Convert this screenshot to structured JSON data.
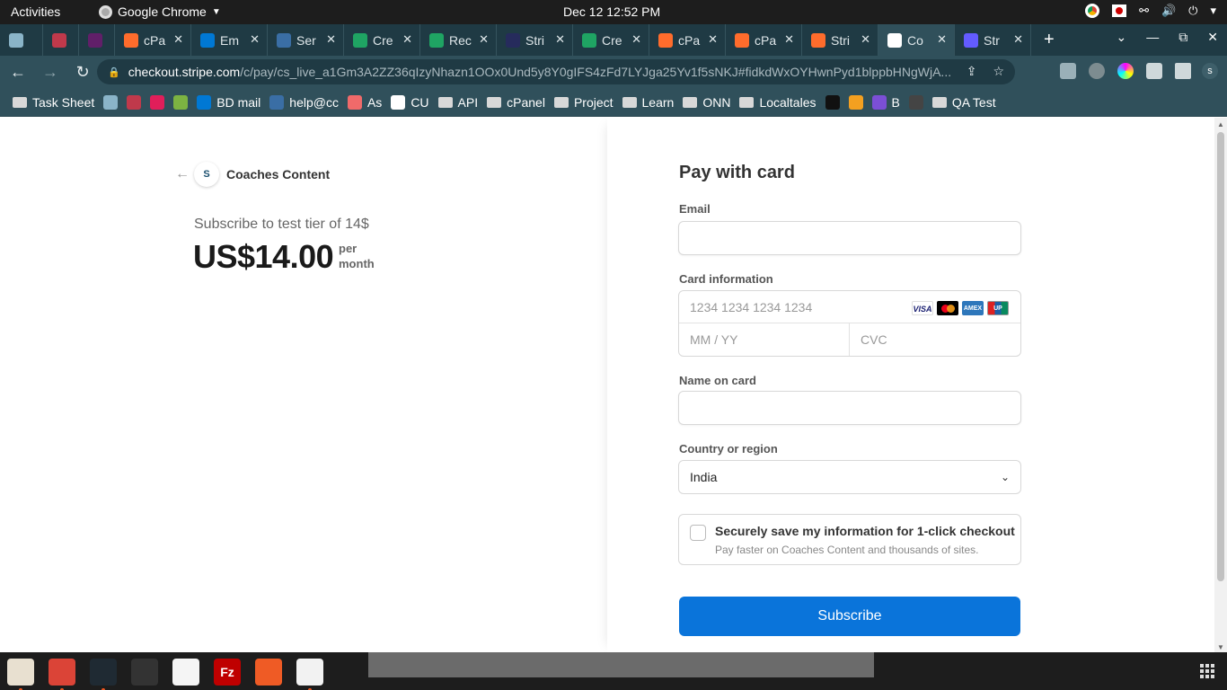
{
  "system": {
    "activities": "Activities",
    "app_name": "Google Chrome",
    "clock": "Dec 12  12:52 PM"
  },
  "tabs": [
    {
      "title": "",
      "favicon": "home-icon",
      "color": "#8ab4c8"
    },
    {
      "title": "",
      "favicon": "chat-icon",
      "color": "#c0394b"
    },
    {
      "title": "",
      "favicon": "slack-icon",
      "color": "#611f69"
    },
    {
      "title": "cPa",
      "favicon": "cpanel-icon",
      "color": "#ff6c2c"
    },
    {
      "title": "Em",
      "favicon": "outlook-icon",
      "color": "#0078d4"
    },
    {
      "title": "Ser",
      "favicon": "cc-icon",
      "color": "#3a6ea5"
    },
    {
      "title": "Cre",
      "favicon": "sheets-icon",
      "color": "#1fa463"
    },
    {
      "title": "Rec",
      "favicon": "sheets-icon",
      "color": "#1fa463"
    },
    {
      "title": "Stri",
      "favicon": "stripe-icon",
      "color": "#262b5c"
    },
    {
      "title": "Cre",
      "favicon": "sheets-icon",
      "color": "#1fa463"
    },
    {
      "title": "cPa",
      "favicon": "cpanel-icon",
      "color": "#ff6c2c"
    },
    {
      "title": "cPa",
      "favicon": "cpanel-icon",
      "color": "#ff6c2c"
    },
    {
      "title": "Stri",
      "favicon": "cpanel-icon",
      "color": "#ff6c2c"
    },
    {
      "title": "Co",
      "favicon": "coaches-icon",
      "color": "#ffffff",
      "active": true
    },
    {
      "title": "Str",
      "favicon": "stripe-icon",
      "color": "#635bff"
    }
  ],
  "address": {
    "host": "checkout.stripe.com",
    "path": "/c/pay/cs_live_a1Gm3A2ZZ36qIzyNhazn1OOx0Und5y8Y0gIFS4zFd7LYJga25Yv1f5sNKJ#fidkdWxOYHwnPyd1blppbHNgWjA..."
  },
  "bookmarks": [
    {
      "label": "Task Sheet",
      "icon": "folder-icon"
    },
    {
      "label": "",
      "icon": "home-icon"
    },
    {
      "label": "",
      "icon": "chat-icon"
    },
    {
      "label": "",
      "icon": "slack-icon"
    },
    {
      "label": "",
      "icon": "green-icon"
    },
    {
      "label": "BD mail",
      "icon": "outlook-icon"
    },
    {
      "label": "help@cc",
      "icon": "cc-icon"
    },
    {
      "label": "As",
      "icon": "asana-icon"
    },
    {
      "label": "CU",
      "icon": "clickup-icon"
    },
    {
      "label": "API",
      "icon": "folder-icon"
    },
    {
      "label": "cPanel",
      "icon": "folder-icon"
    },
    {
      "label": "Project",
      "icon": "folder-icon"
    },
    {
      "label": "Learn",
      "icon": "folder-icon"
    },
    {
      "label": "ONN",
      "icon": "folder-icon"
    },
    {
      "label": "Localtales",
      "icon": "folder-icon"
    },
    {
      "label": "",
      "icon": "github-icon"
    },
    {
      "label": "",
      "icon": "app-icon"
    },
    {
      "label": "B",
      "icon": "b-icon"
    },
    {
      "label": "",
      "icon": "blank-icon"
    },
    {
      "label": "QA Test",
      "icon": "folder-icon"
    }
  ],
  "summary": {
    "merchant": "Coaches Content",
    "merchant_logo": "S",
    "product": "Subscribe to test tier of 14$",
    "price": "US$14.00",
    "interval_1": "per",
    "interval_2": "month"
  },
  "form": {
    "title": "Pay with card",
    "email_label": "Email",
    "email_value": "",
    "card_label": "Card information",
    "card_number_placeholder": "1234 1234 1234 1234",
    "expiry_placeholder": "MM / YY",
    "cvc_placeholder": "CVC",
    "brands": [
      "VISA",
      "",
      "AMEX",
      "UP"
    ],
    "name_label": "Name on card",
    "name_value": "",
    "country_label": "Country or region",
    "country_value": "India",
    "save_title": "Securely save my information for 1-click checkout",
    "save_subtitle": "Pay faster on Coaches Content and thousands of sites.",
    "submit": "Subscribe"
  },
  "dock": [
    {
      "name": "files-icon",
      "color": "#e8e0d0",
      "running": true
    },
    {
      "name": "chrome-icon",
      "color": "#db4437",
      "running": true
    },
    {
      "name": "vscode-icon",
      "color": "#1f2a33",
      "running": true
    },
    {
      "name": "terminal-icon",
      "color": "#333",
      "running": false
    },
    {
      "name": "text-editor-icon",
      "color": "#f5f5f5",
      "running": false
    },
    {
      "name": "filezilla-icon",
      "color": "#bf0000",
      "running": false,
      "label": "Fz"
    },
    {
      "name": "postman-icon",
      "color": "#ef5b25",
      "running": false
    },
    {
      "name": "recorder-icon",
      "color": "#f2f2f2",
      "running": true
    }
  ]
}
